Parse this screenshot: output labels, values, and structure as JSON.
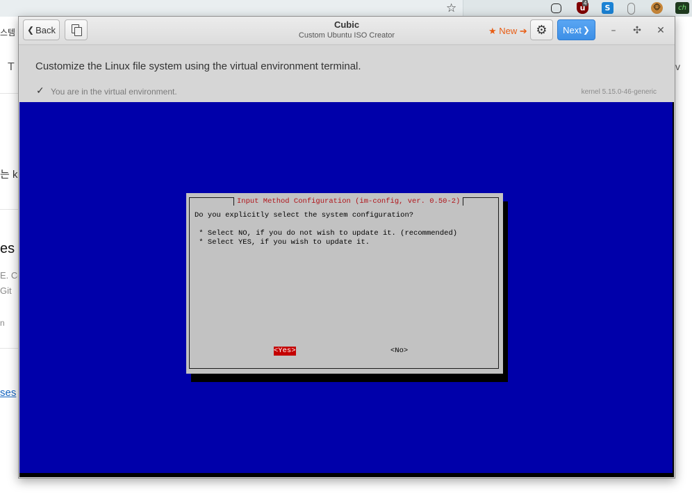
{
  "background": {
    "fragments": {
      "left_1": "스템",
      "left_2": "T",
      "left_3": "는 k",
      "left_4": "es",
      "left_5": "E. Co",
      "left_6": "Git",
      "left_7": "n",
      "left_8": "ses",
      "right_1": "v"
    },
    "extensions": {
      "ublock_badge": "4",
      "ch_label": "ch",
      "s_label": "S"
    }
  },
  "header": {
    "back_label": "Back",
    "title": "Cubic",
    "subtitle": "Custom Ubuntu ISO Creator",
    "new_label": "★ New ➔",
    "next_label": "Next"
  },
  "instructions": "Customize the Linux file system using the virtual environment terminal.",
  "status": {
    "text": "You are in the virtual environment.",
    "kernel": "kernel 5.15.0-46-generic"
  },
  "dialog": {
    "title": "Input Method Configuration (im-config, ver. 0.50-2)",
    "question": "Do you explicitly select the system configuration?",
    "lines": [
      " * Select NO, if you do not wish to update it. (recommended)",
      " * Select YES, if you wish to update it."
    ],
    "yes_label": "<Yes>",
    "no_label": "<No>"
  },
  "colors": {
    "terminal_bg": "#0000aa",
    "dialog_bg": "#c2c2c2",
    "title_text": "#b0141a",
    "selected_button": "#c40000",
    "next_button": "#3d8fe6",
    "new_link": "#e85d14"
  }
}
